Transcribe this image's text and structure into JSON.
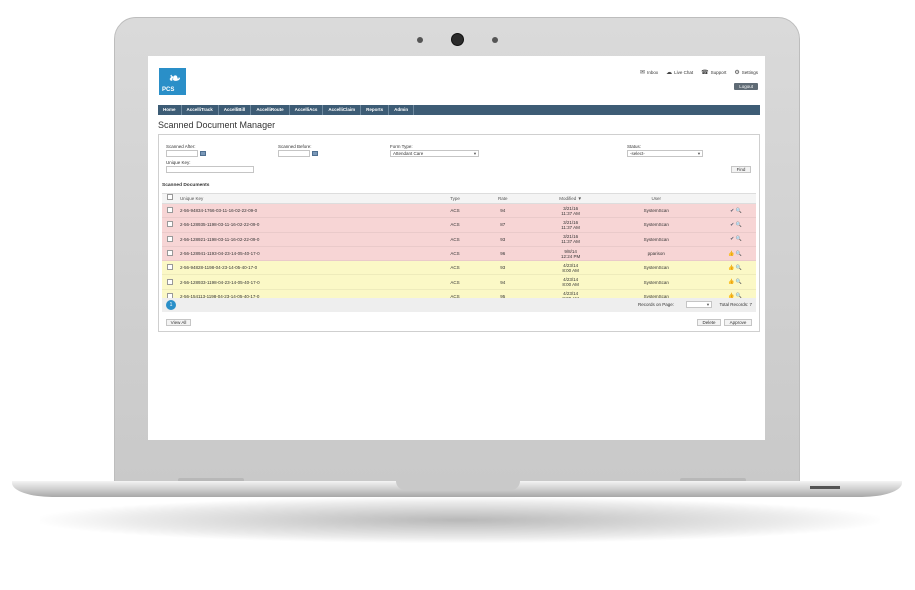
{
  "header": {
    "logo_text": "PCS",
    "links": [
      {
        "icon": "mail-icon",
        "glyph": "✉",
        "label": "Inbox"
      },
      {
        "icon": "chat-icon",
        "glyph": "☁",
        "label": "Live Chat"
      },
      {
        "icon": "phone-icon",
        "glyph": "☎",
        "label": "Support"
      },
      {
        "icon": "gear-icon",
        "glyph": "⚙",
        "label": "Settings"
      }
    ],
    "logout_label": "Logout"
  },
  "nav": [
    "Home",
    "AccelliTrack",
    "AccelliBill",
    "AccelliRoute",
    "AccelliAcs",
    "AccelliClaim",
    "Reports",
    "Admin"
  ],
  "page_title": "Scanned Document Manager",
  "filters": {
    "scanned_after_label": "Scanned After:",
    "scanned_before_label": "Scanned Before:",
    "form_type_label": "Form Type:",
    "form_type_value": "Attendant Care",
    "status_label": "Status:",
    "status_value": "-select-",
    "unique_key_label": "Unique Key:",
    "find_label": "Find"
  },
  "section_title": "Scanned Documents",
  "table": {
    "headers": {
      "key": "Unique Key",
      "type": "Type",
      "rate": "Rate",
      "modified": "Modified ▼",
      "user": "User"
    },
    "rows": [
      {
        "key": "2-56-94834-1766-03-11-16-02-22-09-0",
        "type": "ACS",
        "rate": "94",
        "date": "3/21/16",
        "time": "11:37 AM",
        "user": "SystemScan",
        "actions": "✔ 🔍",
        "color": "pink"
      },
      {
        "key": "2-56-128935-1198-03-11-16-02-22-09-0",
        "type": "ACS",
        "rate": "87",
        "date": "3/21/16",
        "time": "11:37 AM",
        "user": "SystemScan",
        "actions": "✔ 🔍",
        "color": "pink"
      },
      {
        "key": "2-56-128921-1198-03-11-16-02-22-09-0",
        "type": "ACS",
        "rate": "93",
        "date": "3/21/16",
        "time": "11:37 AM",
        "user": "SystemScan",
        "actions": "✔ 🔍",
        "color": "pink"
      },
      {
        "key": "2-56-128941-1193-04-23-14-05-40-17-0",
        "type": "ACS",
        "rate": "96",
        "date": "9/8/14",
        "time": "12:24 PM",
        "user": "pparison",
        "actions": "👍 🔍",
        "color": "pink"
      },
      {
        "key": "2-56-94828-1198-04-23-14-05-40-17-0",
        "type": "ACS",
        "rate": "93",
        "date": "4/23/14",
        "time": "8:00 AM",
        "user": "SystemScan",
        "actions": "👍 🔍",
        "color": "yellow"
      },
      {
        "key": "2-56-128933-1198-04-23-14-05-40-17-0",
        "type": "ACS",
        "rate": "94",
        "date": "4/23/14",
        "time": "8:00 AM",
        "user": "SystemScan",
        "actions": "👍 🔍",
        "color": "yellow"
      },
      {
        "key": "2-56-154113-1198-04-23-14-05-40-17-0",
        "type": "ACS",
        "rate": "95",
        "date": "4/23/14",
        "time": "8:00 AM",
        "user": "SystemScan",
        "actions": "👍 🔍",
        "color": "yellow"
      }
    ]
  },
  "pager": {
    "page": "1",
    "records_label": "Records on Page:",
    "total_label": "Total Records: 7"
  },
  "buttons": {
    "view_all": "View All",
    "delete": "Delete",
    "approve": "Approve"
  },
  "colors": {
    "accent": "#2a8fc8",
    "nav_bg": "#3d5c75",
    "row_pink": "#f7d5d5",
    "row_yellow": "#fbf8c6"
  }
}
